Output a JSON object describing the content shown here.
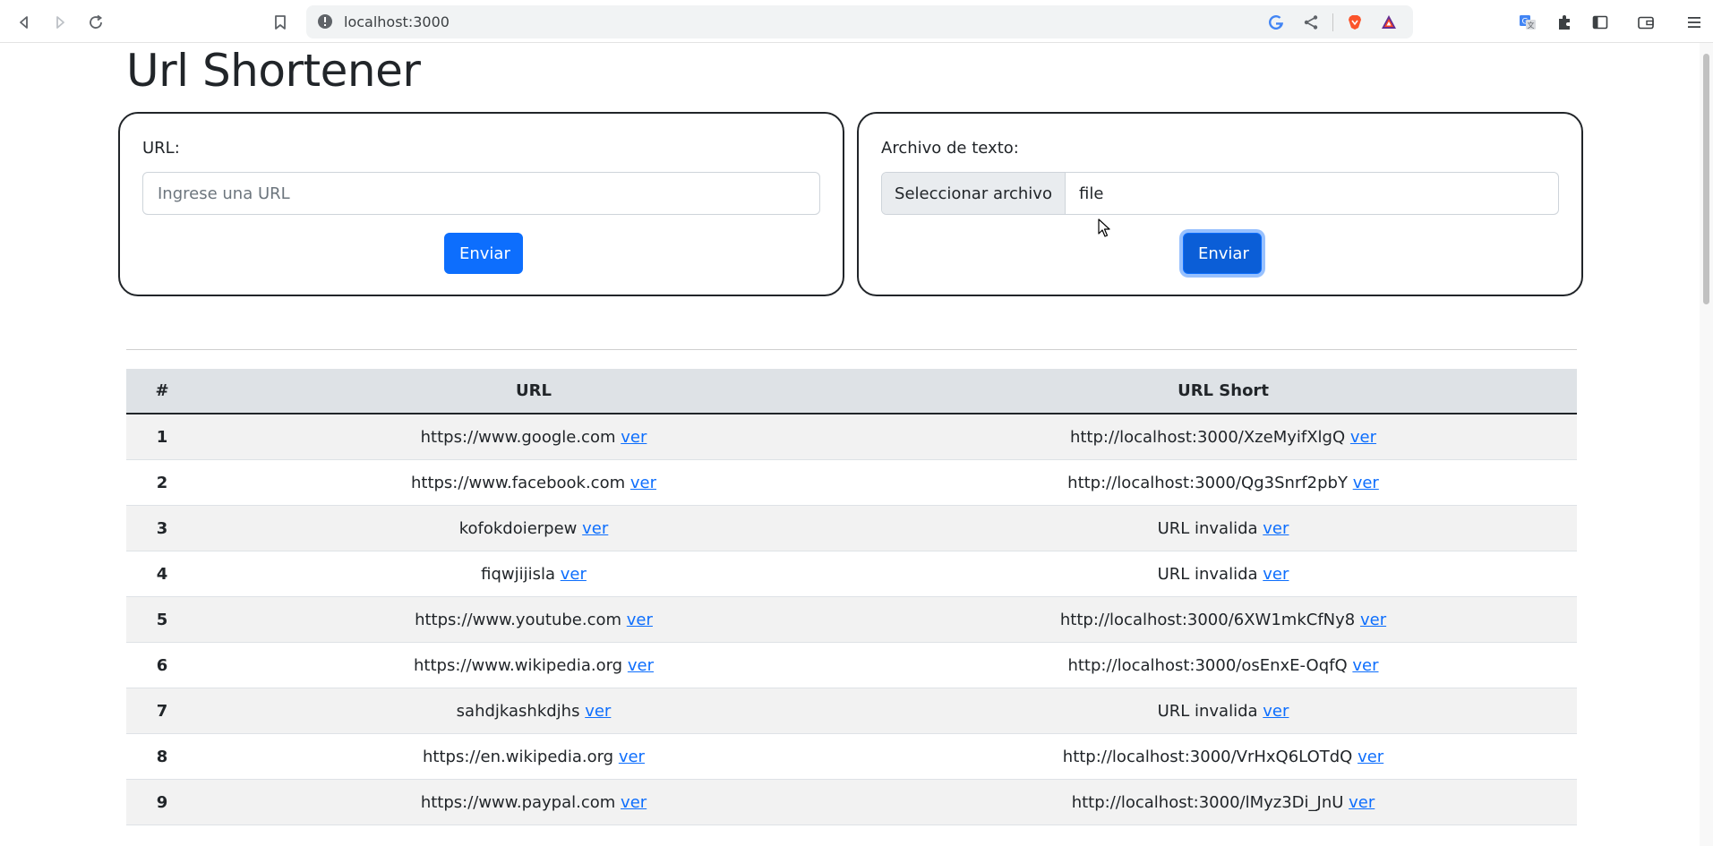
{
  "browser": {
    "address": "localhost:3000"
  },
  "page": {
    "title": "Url Shortener",
    "url_form": {
      "label": "URL:",
      "placeholder": "Ingrese una URL",
      "submit_label": "Enviar"
    },
    "file_form": {
      "label": "Archivo de texto:",
      "choose_label": "Seleccionar archivo",
      "file_name": "file",
      "submit_label": "Enviar"
    },
    "table": {
      "headers": [
        "#",
        "URL",
        "URL Short"
      ],
      "link_label": "ver",
      "rows": [
        {
          "num": "1",
          "url": "https://www.google.com",
          "short": "http://localhost:3000/XzeMyifXlgQ"
        },
        {
          "num": "2",
          "url": "https://www.facebook.com",
          "short": "http://localhost:3000/Qg3Snrf2pbY"
        },
        {
          "num": "3",
          "url": "kofokdoierpew",
          "short": "URL invalida"
        },
        {
          "num": "4",
          "url": "fiqwjijisla",
          "short": "URL invalida"
        },
        {
          "num": "5",
          "url": "https://www.youtube.com",
          "short": "http://localhost:3000/6XW1mkCfNy8"
        },
        {
          "num": "6",
          "url": "https://www.wikipedia.org",
          "short": "http://localhost:3000/osEnxE-OqfQ"
        },
        {
          "num": "7",
          "url": "sahdjkashkdjhs",
          "short": "URL invalida"
        },
        {
          "num": "8",
          "url": "https://en.wikipedia.org",
          "short": "http://localhost:3000/VrHxQ6LOTdQ"
        },
        {
          "num": "9",
          "url": "https://www.paypal.com",
          "short": "http://localhost:3000/lMyz3Di_JnU"
        }
      ]
    }
  },
  "colors": {
    "primary": "#0d6efd",
    "header_bg": "#dee2e6",
    "stripe_bg": "#f2f2f2"
  }
}
